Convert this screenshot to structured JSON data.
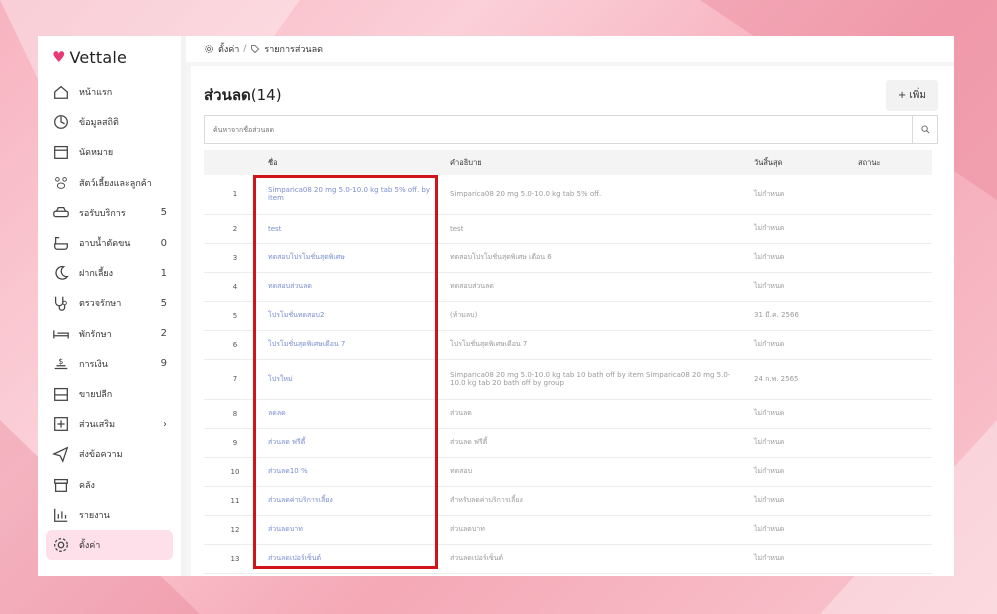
{
  "app": {
    "brand": "Vettale"
  },
  "breadcrumb": {
    "root": "ตั้งค่า",
    "separator": "/",
    "current": "รายการส่วนลด"
  },
  "sidebar": {
    "items": [
      {
        "label": "หน้าแรก",
        "count": ""
      },
      {
        "label": "ข้อมูลสถิติ",
        "count": ""
      },
      {
        "label": "นัดหมาย",
        "count": ""
      },
      {
        "label": "สัตว์เลี้ยงและลูกค้า",
        "count": ""
      },
      {
        "label": "รอรับบริการ",
        "count": "5"
      },
      {
        "label": "อาบน้ำตัดขน",
        "count": "0"
      },
      {
        "label": "ฝากเลี้ยง",
        "count": "1"
      },
      {
        "label": "ตรวจรักษา",
        "count": "5"
      },
      {
        "label": "พักรักษา",
        "count": "2"
      },
      {
        "label": "การเงิน",
        "count": "9"
      },
      {
        "label": "ขายปลีก",
        "count": ""
      },
      {
        "label": "ส่วนเสริม",
        "count": "›"
      },
      {
        "label": "ส่งข้อความ",
        "count": ""
      },
      {
        "label": "คลัง",
        "count": ""
      },
      {
        "label": "รายงาน",
        "count": ""
      },
      {
        "label": "ตั้งค่า",
        "count": ""
      }
    ]
  },
  "page": {
    "title": "ส่วนลด",
    "count": "(14)",
    "add_label": "+ เพิ่ม",
    "search_placeholder": "ค้นหาจากชื่อส่วนลด"
  },
  "table": {
    "headers": [
      "",
      "ชื่อ",
      "คำอธิบาย",
      "วันสิ้นสุด",
      "สถานะ"
    ],
    "rows": [
      {
        "no": "1",
        "name": "Simparica08 20 mg 5.0-10.0 kg tab 5% off. by item",
        "desc": "Simparica08 20 mg 5.0-10.0 kg tab 5% off.",
        "end": "ไม่กำหนด",
        "status": ""
      },
      {
        "no": "2",
        "name": "test",
        "desc": "test",
        "end": "ไม่กำหนด",
        "status": ""
      },
      {
        "no": "3",
        "name": "ทดสอบโปรโมชั่นสุดพิเศษ",
        "desc": "ทดสอบโปรโมชั่นสุดพิเศษ เดือน 6",
        "end": "ไม่กำหนด",
        "status": ""
      },
      {
        "no": "4",
        "name": "ทดสอบส่วนลด",
        "desc": "ทดสอบส่วนลด",
        "end": "ไม่กำหนด",
        "status": ""
      },
      {
        "no": "5",
        "name": "โปรโมชั่นทดสอบ2",
        "desc": "(ห้ามลบ)",
        "end": "31 มี.ค. 2566",
        "status": ""
      },
      {
        "no": "6",
        "name": "โปรโมชั่นสุดพิเศษเดือน 7",
        "desc": "โปรโมชั่นสุดพิเศษเดือน 7",
        "end": "ไม่กำหนด",
        "status": ""
      },
      {
        "no": "7",
        "name": "โปรใหม่",
        "desc": "Simparica08 20 mg 5.0-10.0 kg tab 10 bath off by item Simparica08 20 mg 5.0-10.0 kg tab 20 bath off by group",
        "end": "24 ก.พ. 2565",
        "status": ""
      },
      {
        "no": "8",
        "name": "ลดลด",
        "desc": "ส่วนลด",
        "end": "ไม่กำหนด",
        "status": ""
      },
      {
        "no": "9",
        "name": "ส่วนลด ฟรีดี้",
        "desc": "ส่วนลด ฟรีดี้",
        "end": "ไม่กำหนด",
        "status": ""
      },
      {
        "no": "10",
        "name": "ส่วนลด10 %",
        "desc": "ทดสอบ",
        "end": "ไม่กำหนด",
        "status": ""
      },
      {
        "no": "11",
        "name": "ส่วนลดค่าบริการเลี้ยง",
        "desc": "สำหรับลดค่าบริการเลี้ยง",
        "end": "ไม่กำหนด",
        "status": ""
      },
      {
        "no": "12",
        "name": "ส่วนลดบาท",
        "desc": "ส่วนลดบาท",
        "end": "ไม่กำหนด",
        "status": ""
      },
      {
        "no": "13",
        "name": "ส่วนลดเปอร์เซ็นต์",
        "desc": "ส่วนลดเปอร์เซ็นต์",
        "end": "ไม่กำหนด",
        "status": ""
      }
    ]
  },
  "colors": {
    "accent": "#e73b77",
    "active_bg": "#fde0ea",
    "link": "#7a8fd0",
    "highlight": "#d0141b"
  },
  "icons": [
    "home-icon",
    "stats-icon",
    "calendar-icon",
    "paw-icon",
    "car-icon",
    "bathtub-icon",
    "moon-icon",
    "stethoscope-icon",
    "bed-icon",
    "money-icon",
    "cash-register-icon",
    "plus-box-icon",
    "send-icon",
    "archive-icon",
    "chart-icon",
    "gear-icon"
  ]
}
